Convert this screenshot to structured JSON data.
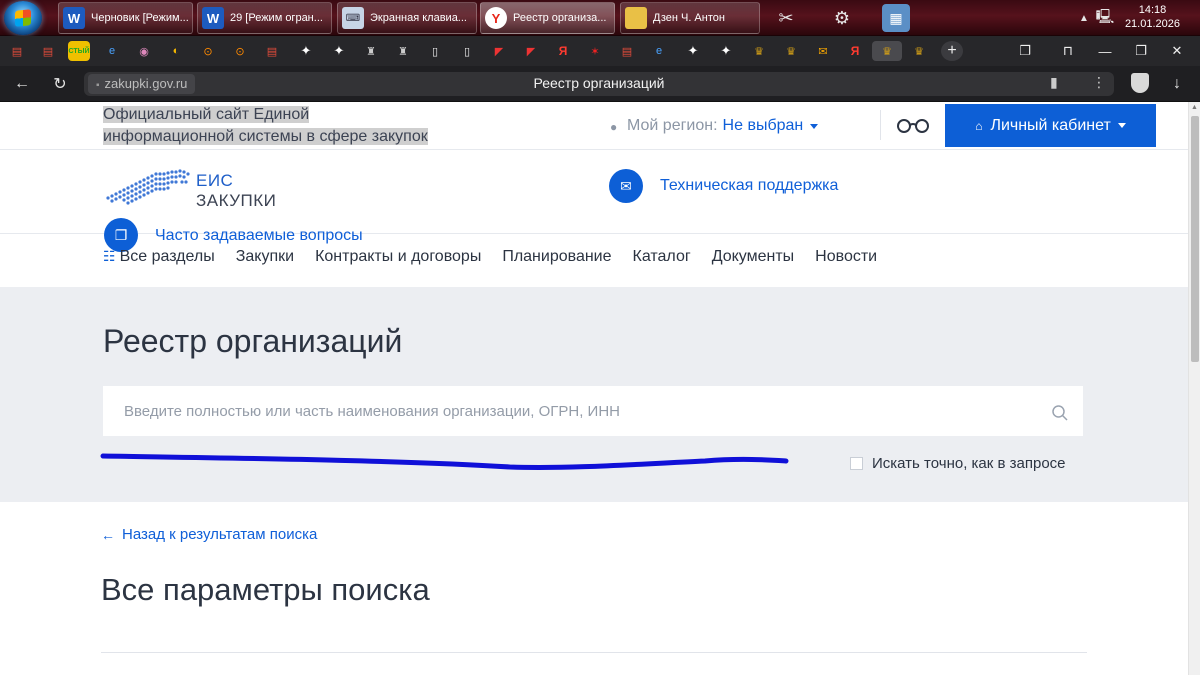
{
  "taskbar": {
    "buttons": [
      {
        "label": "Черновик [Режим...",
        "icon": "word-icon"
      },
      {
        "label": "29 [Режим огран...",
        "icon": "word-icon"
      },
      {
        "label": "Экранная клавиа...",
        "icon": "keyboard-icon"
      },
      {
        "label": "Реестр организа...",
        "icon": "yandex-browser-icon"
      },
      {
        "label": "Дзен Ч. Антон",
        "icon": "folder-icon"
      }
    ],
    "clock": {
      "time": "14:18",
      "date": "21.01.2026"
    },
    "colors": {
      "background": "#4a0e18"
    }
  },
  "browser": {
    "host": "zakupki.gov.ru",
    "tab_title": "Реестр организаций"
  },
  "site": {
    "official_text": "Официальный сайт Единой информационной системы в сфере закупок",
    "region_label": "Мой регион:",
    "region_value": "Не выбран",
    "cabinet_button": "Личный кабинет",
    "logo_line1": "ЕИС",
    "logo_line2": "ЗАКУПКИ",
    "support_link": "Техническая поддержка",
    "faq_link": "Часто задаваемые вопросы",
    "menu": [
      "Все разделы",
      "Закупки",
      "Контракты и договоры",
      "Планирование",
      "Каталог",
      "Документы",
      "Новости"
    ],
    "colors": {
      "primary": "#0d5fd6",
      "link": "#0f5fd8",
      "text": "#2c3442",
      "band": "#eceef2"
    }
  },
  "search": {
    "page_title": "Реестр организаций",
    "placeholder": "Введите полностью или часть наименования организации, ОГРН, ИНН",
    "value": "",
    "exact_label": "Искать точно, как в запросе",
    "exact_checked": false,
    "scribble_color": "#1010d8"
  },
  "content": {
    "back_link": "Назад к результатам поиска",
    "params_title": "Все параметры поиска"
  }
}
